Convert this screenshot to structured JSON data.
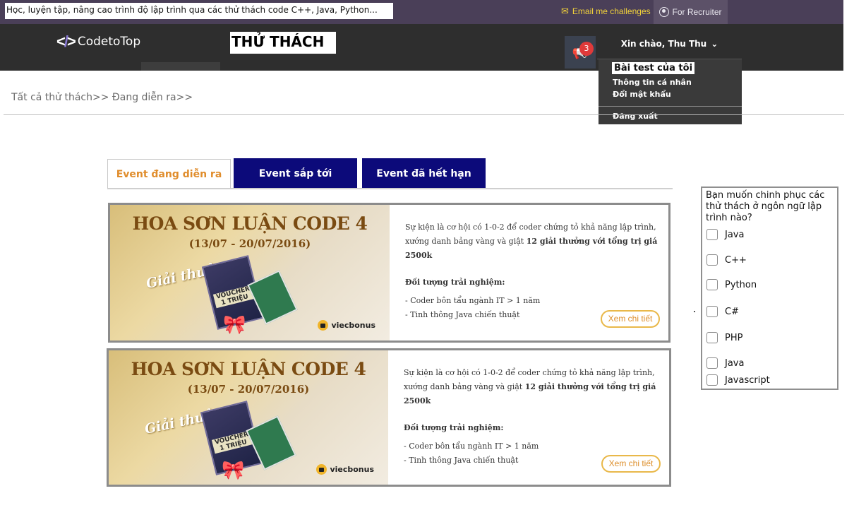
{
  "topbar": {
    "tagline": "Học, luyện tập, nâng cao trình độ lập trình qua các thử thách code C++, Java, Python...",
    "email_link": "Email me challenges",
    "recruiter_link": "For Recruiter"
  },
  "nav": {
    "logo_text": "CodetoTop",
    "page_title": "THỬ THÁCH",
    "notification_count": "3",
    "greeting": "Xin chào, Thu Thu",
    "menu": {
      "my_tests": "Bài test của tôi",
      "profile": "Thông tin cá nhân",
      "change_password": "Đổi mật khẩu",
      "logout": "Đăng xuất"
    }
  },
  "breadcrumb": "Tất cả thử thách>> Đang diễn ra>>",
  "tabs": [
    "Event đang diễn ra",
    "Event sắp tới",
    "Event đã hết hạn"
  ],
  "events": [
    {
      "banner_title": "HOA SƠN LUẬN CODE 4",
      "banner_date": "(13/07 - 20/07/2016)",
      "banner_prize": "Giải thưởng",
      "voucher": "VOUCHER 1 TRIỆU",
      "sponsor": "viecbonus",
      "intro": "Sự kiện là cơ hội có 1-0-2 để coder chứng tỏ khả năng lập trình, xướng danh bảng vàng và giật ",
      "intro_strong": "12 giải thưởng với tổng trị giá 2500k",
      "audience_title": "Đối tượng trải nghiệm:",
      "audience_1": "- Coder bôn tẩu ngành IT > 1 năm",
      "audience_2": "- Tinh thông Java chiến thuật",
      "more": "Xem chi tiết"
    },
    {
      "banner_title": "HOA SƠN LUẬN CODE 4",
      "banner_date": "(13/07 - 20/07/2016)",
      "banner_prize": "Giải thưởng",
      "voucher": "VOUCHER 1 TRIỆU",
      "sponsor": "viecbonus",
      "intro": "Sự kiện là cơ hội có 1-0-2 để coder chứng tỏ khả năng lập trình, xướng danh bảng vàng và giật ",
      "intro_strong": "12 giải thưởng với tổng trị giá 2500k",
      "audience_title": "Đối tượng trải nghiệm:",
      "audience_1": "- Coder bôn tẩu ngành IT > 1 năm",
      "audience_2": "- Tinh thông Java chiến thuật",
      "more": "Xem chi tiết"
    }
  ],
  "filter": {
    "question": "Bạn muốn chinh phục các thử thách ở ngôn ngữ lập trình nào?",
    "options": [
      "Java",
      "C++",
      "Python",
      "C#",
      "PHP",
      "Java",
      "Javascript"
    ]
  },
  "colors": {
    "topbar": "#4a3f58",
    "navbar": "#2e2e2e",
    "tab_dark": "#0c0a7a",
    "accent_orange": "#e08d2c",
    "badge_red": "#e03a3a"
  }
}
